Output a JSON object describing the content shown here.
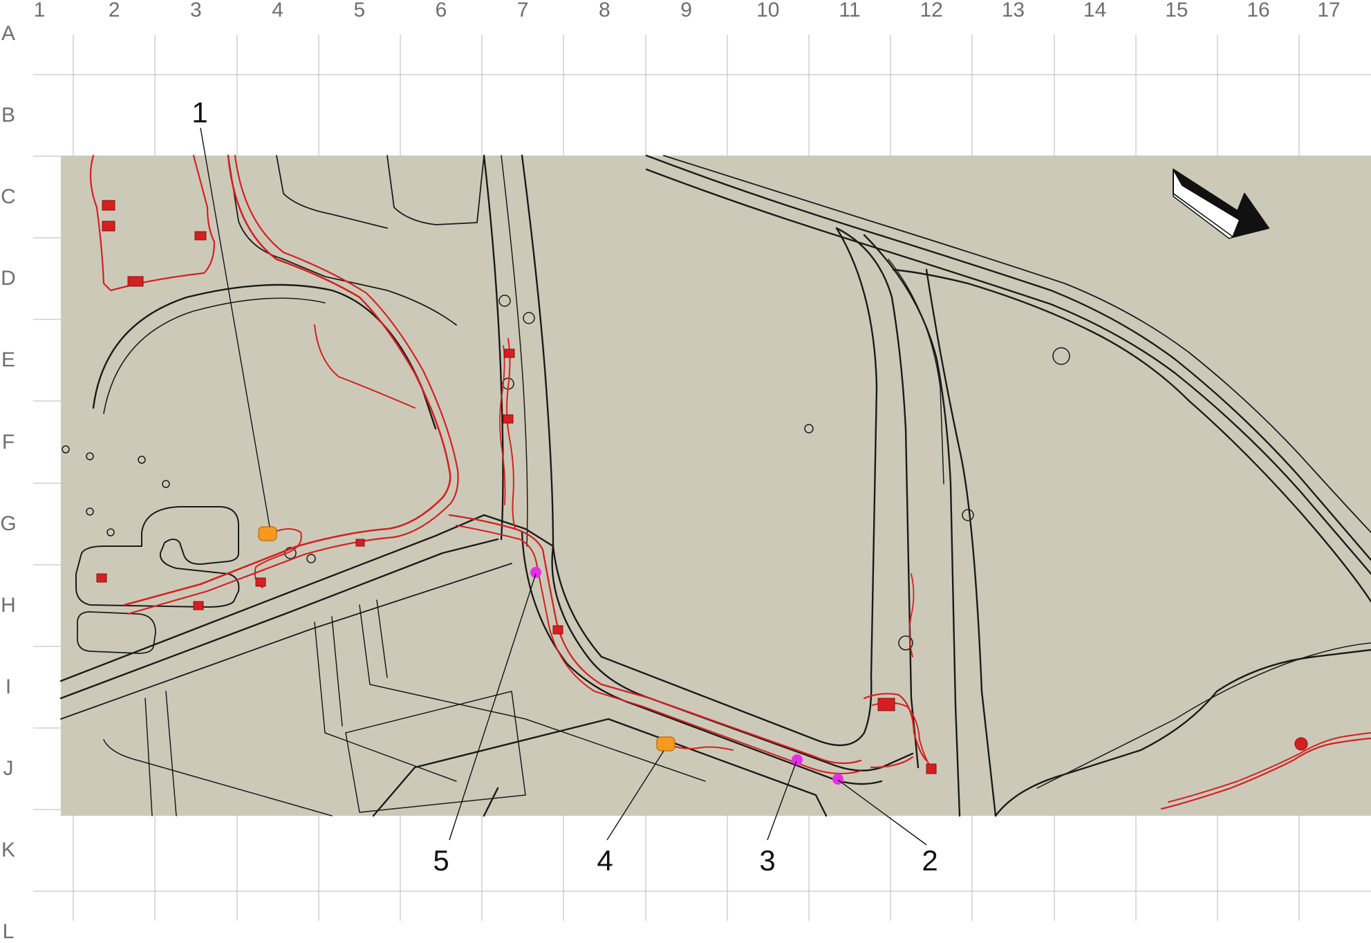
{
  "grid": {
    "columns": [
      "1",
      "2",
      "3",
      "4",
      "5",
      "6",
      "7",
      "8",
      "9",
      "10",
      "11",
      "12",
      "13",
      "14",
      "15",
      "16",
      "17"
    ],
    "rows": [
      "A",
      "B",
      "C",
      "D",
      "E",
      "F",
      "G",
      "H",
      "I",
      "J",
      "K",
      "L"
    ]
  },
  "callouts": [
    {
      "label": "1",
      "marker": "connector-orange"
    },
    {
      "label": "2",
      "marker": "ground-magenta"
    },
    {
      "label": "3",
      "marker": "ground-magenta"
    },
    {
      "label": "4",
      "marker": "connector-orange"
    },
    {
      "label": "5",
      "marker": "ground-magenta"
    }
  ],
  "colors": {
    "panel_fill": "#cdc9b8",
    "body_line": "#1a1a1a",
    "harness": "#d42020",
    "connector": "#f59a1c",
    "ground_point": "#e62ee6",
    "grid_line": "#c8c8c8",
    "grid_label": "#6e6e6e"
  },
  "icons": {
    "orientation_arrow": "forward-direction-arrow-icon"
  }
}
